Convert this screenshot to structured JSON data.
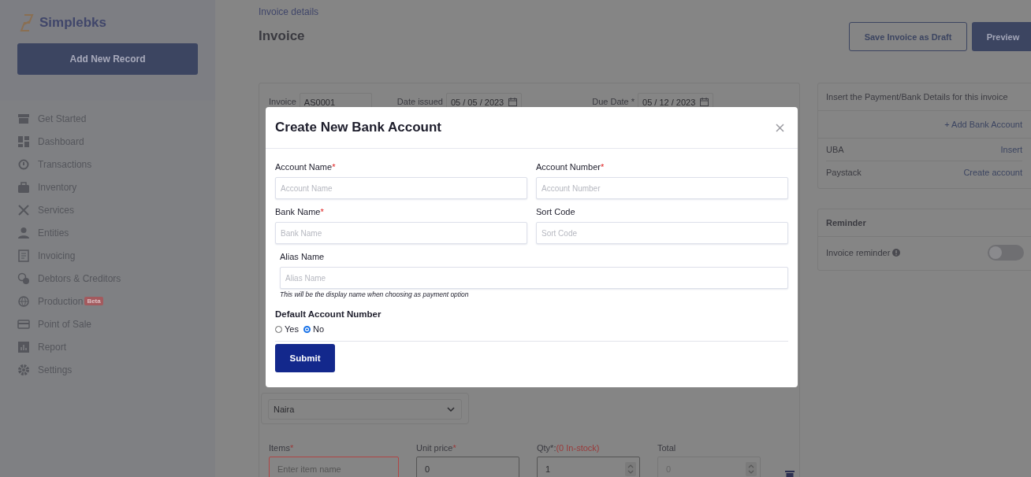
{
  "sidebar": {
    "logo": "Simplebks",
    "add_button": "Add New Record",
    "items": [
      {
        "label": "Get Started"
      },
      {
        "label": "Dashboard"
      },
      {
        "label": "Transactions"
      },
      {
        "label": "Inventory"
      },
      {
        "label": "Services"
      },
      {
        "label": "Entities"
      },
      {
        "label": "Invoicing"
      },
      {
        "label": "Debtors & Creditors"
      },
      {
        "label": "Production",
        "badge": "Beta"
      },
      {
        "label": "Point of Sale"
      },
      {
        "label": "Report"
      },
      {
        "label": "Settings"
      }
    ]
  },
  "header": {
    "breadcrumb": "Invoice details",
    "title": "Invoice",
    "buttons": [
      {
        "label": "Save Invoice as Draft",
        "kind": "outline"
      },
      {
        "label": "Preview",
        "kind": "primary"
      }
    ]
  },
  "invoice_form": {
    "fields": [
      {
        "label": "Invoice",
        "value": "AS0001",
        "kind": "text"
      },
      {
        "label": "Date issued",
        "value": "05 / 05 / 2023",
        "kind": "date"
      },
      {
        "label": "Due Date *",
        "value": "05 / 12 / 2023",
        "kind": "date"
      }
    ],
    "currency": "Naira",
    "item_columns": [
      {
        "label": "Items",
        "required_mark": "*",
        "placeholder": "Enter item name",
        "error": true,
        "kind": "text"
      },
      {
        "label": "Unit price",
        "required_mark": "*",
        "value": "0",
        "kind": "text"
      },
      {
        "label": "Qty*:",
        "note": "(0 In-stock)",
        "value": "1",
        "kind": "number"
      },
      {
        "label": "Total",
        "value": "0",
        "kind": "number",
        "disabled": true
      }
    ]
  },
  "bank_details": {
    "title": "Insert the Payment/Bank Details for this invoice",
    "add_link": "+ Add Bank Account",
    "accounts": [
      {
        "name": "UBA",
        "action": "Insert"
      },
      {
        "name": "Paystack",
        "action": "Create account"
      }
    ]
  },
  "reminder": {
    "title": "Reminder",
    "label": "Invoice reminder",
    "on": false
  },
  "modal": {
    "title": "Create New Bank Account",
    "fields": [
      {
        "label": "Account Name",
        "required_mark": "*",
        "placeholder": "Account Name"
      },
      {
        "label": "Account Number",
        "required_mark": "*",
        "placeholder": "Account Number"
      },
      {
        "label": "Bank Name",
        "required_mark": "*",
        "placeholder": "Bank Name"
      },
      {
        "label": "Sort Code",
        "placeholder": "Sort Code"
      }
    ],
    "alias": {
      "label": "Alias Name",
      "placeholder": "Alias Name",
      "hint": "This will be the display name when choosing as payment option"
    },
    "default_account": {
      "label": "Default Account Number",
      "options": [
        {
          "label": "Yes",
          "selected": false
        },
        {
          "label": "No",
          "selected": true
        }
      ]
    },
    "submit": "Submit"
  }
}
